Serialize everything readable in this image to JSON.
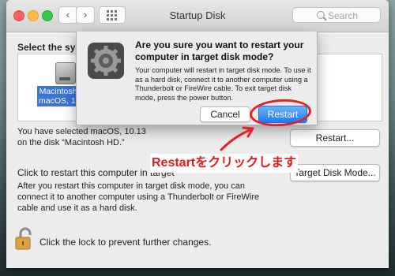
{
  "window": {
    "title": "Startup Disk",
    "search_placeholder": "Search"
  },
  "main": {
    "select_label": "Select the syste",
    "disk": {
      "name_line1": "Macintosh HD",
      "name_line2": "macOS, 10.13"
    },
    "selected_text_line1": "You have selected macOS, 10.13",
    "selected_text_line2": "on the disk “Macintosh HD.”",
    "restart_button": "Restart...",
    "click_restart_label": "Click to restart this computer in target",
    "target_disk_button": "Target Disk Mode...",
    "target_desc": "After you restart this computer in target disk mode, you can connect it to another computer using a Thunderbolt or FireWire cable and use it as a hard disk.",
    "lock_text": "Click the lock to prevent further changes."
  },
  "dialog": {
    "title": "Are you sure you want to restart your computer in target disk mode?",
    "body": "Your computer will restart in target disk mode. To use it as a hard disk, connect it to another computer using a Thunderbolt or FireWire cable. To exit target disk mode, press the power button.",
    "cancel": "Cancel",
    "confirm": "Restart"
  },
  "annotation": {
    "text": "Restartをクリックします",
    "color": "#e41b1b"
  }
}
